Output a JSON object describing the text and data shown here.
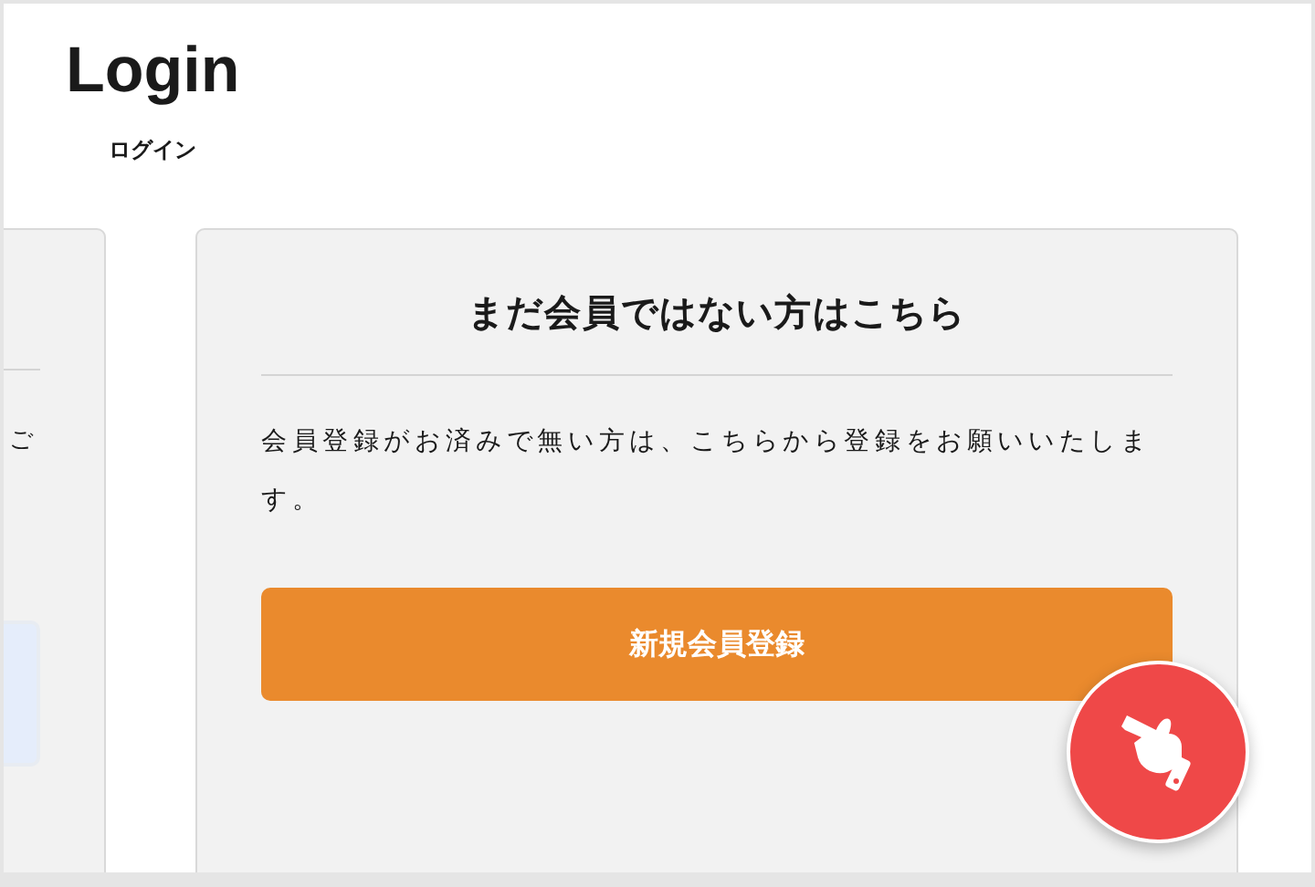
{
  "header": {
    "title": "Login",
    "subtitle": "ログイン"
  },
  "login_card": {
    "text_fragment": "ご"
  },
  "register_card": {
    "title": "まだ会員ではない方はこちら",
    "description": "会員登録がお済みで無い方は、こちらから登録をお願いいたします。",
    "button": "新規会員登録"
  }
}
